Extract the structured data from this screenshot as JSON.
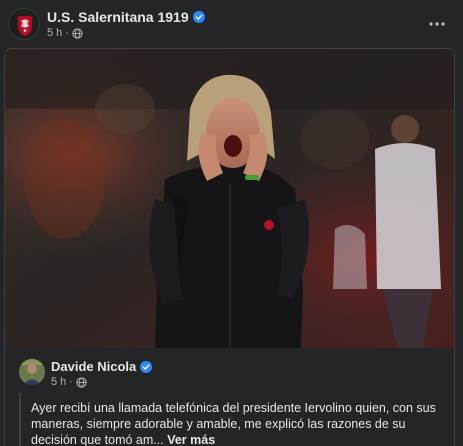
{
  "post": {
    "page_name": "U.S. Salernitana 1919",
    "timestamp": "5 h",
    "audience_icon": "globe-icon",
    "verified_icon": "verified-badge-icon",
    "more_icon": "more-options-icon"
  },
  "shared_post": {
    "author_name": "Davide Nicola",
    "timestamp": "5 h",
    "text": "Ayer recibí una llamada telefónica del presidente Iervolino quien, con sus maneras, siempre adorable y amable, me explicó las razones de su decisión que tomó am...",
    "see_more_label": "Ver más"
  },
  "colors": {
    "background": "#242526",
    "text_primary": "#e4e6eb",
    "text_secondary": "#b0b3b8",
    "verified_blue": "#2d88ff",
    "brand_red": "#b5122a"
  }
}
